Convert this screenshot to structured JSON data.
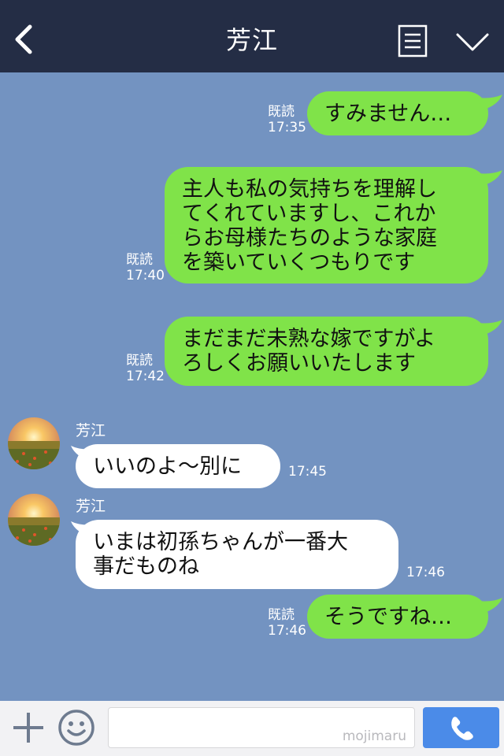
{
  "header": {
    "title": "芳江"
  },
  "messages": [
    {
      "side": "out",
      "text_lines": [
        "すみません…"
      ],
      "read": "既読",
      "time": "17:35"
    },
    {
      "side": "out",
      "text_lines": [
        "主人も私の気持ちを理解し",
        "てくれていますし、これか",
        "らお母様たちのような家庭",
        "を築いていくつもりです"
      ],
      "read": "既読",
      "time": "17:40"
    },
    {
      "side": "out",
      "text_lines": [
        "まだまだ未熟な嫁ですがよ",
        "ろしくお願いいたします"
      ],
      "read": "既読",
      "time": "17:42"
    },
    {
      "side": "in",
      "sender": "芳江",
      "text_lines": [
        "いいのよ〜別に"
      ],
      "time": "17:45"
    },
    {
      "side": "in",
      "sender": "芳江",
      "text_lines": [
        "いまは初孫ちゃんが一番大",
        "事だものね"
      ],
      "time": "17:46"
    },
    {
      "side": "out",
      "text_lines": [
        "そうですね…"
      ],
      "read": "既読",
      "time": "17:46"
    }
  ],
  "footer": {
    "watermark": "mojimaru"
  },
  "colors": {
    "header_bg": "#242d45",
    "chat_bg": "#7393c1",
    "out_bubble": "#80e349",
    "in_bubble": "#ffffff",
    "call_button": "#4b8be8"
  }
}
